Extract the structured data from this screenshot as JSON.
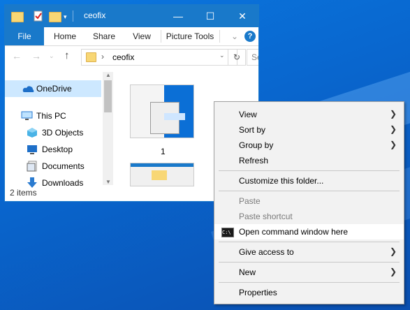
{
  "window": {
    "title": "ceofix",
    "controls": {
      "minimize": "—",
      "maximize": "☐",
      "close": "✕"
    }
  },
  "ribbon": {
    "tabs": [
      "File",
      "Home",
      "Share",
      "View",
      "Picture Tools"
    ],
    "help": "?"
  },
  "address": {
    "path": "ceofix",
    "search_placeholder": "Se"
  },
  "nav": {
    "items": [
      {
        "label": "OneDrive",
        "icon": "onedrive-cloud-icon",
        "selected": true
      },
      {
        "label": "This PC",
        "icon": "computer-icon"
      },
      {
        "label": "3D Objects",
        "icon": "cube-icon"
      },
      {
        "label": "Desktop",
        "icon": "desktop-icon"
      },
      {
        "label": "Documents",
        "icon": "documents-icon"
      },
      {
        "label": "Downloads",
        "icon": "download-arrow-icon"
      }
    ]
  },
  "content": {
    "items": [
      {
        "label": "1"
      }
    ]
  },
  "status": {
    "text": "2 items"
  },
  "context_menu": {
    "items": [
      {
        "label": "View",
        "submenu": true
      },
      {
        "label": "Sort by",
        "submenu": true
      },
      {
        "label": "Group by",
        "submenu": true
      },
      {
        "label": "Refresh"
      },
      {
        "label": "Customize this folder..."
      },
      {
        "label": "Paste",
        "disabled": true
      },
      {
        "label": "Paste shortcut",
        "disabled": true
      },
      {
        "label": "Open command window here",
        "icon": "command-prompt-icon",
        "hover": true
      },
      {
        "label": "Give access to",
        "submenu": true
      },
      {
        "label": "New",
        "submenu": true
      },
      {
        "label": "Properties"
      }
    ],
    "cmd_icon_text": "C:\\"
  }
}
